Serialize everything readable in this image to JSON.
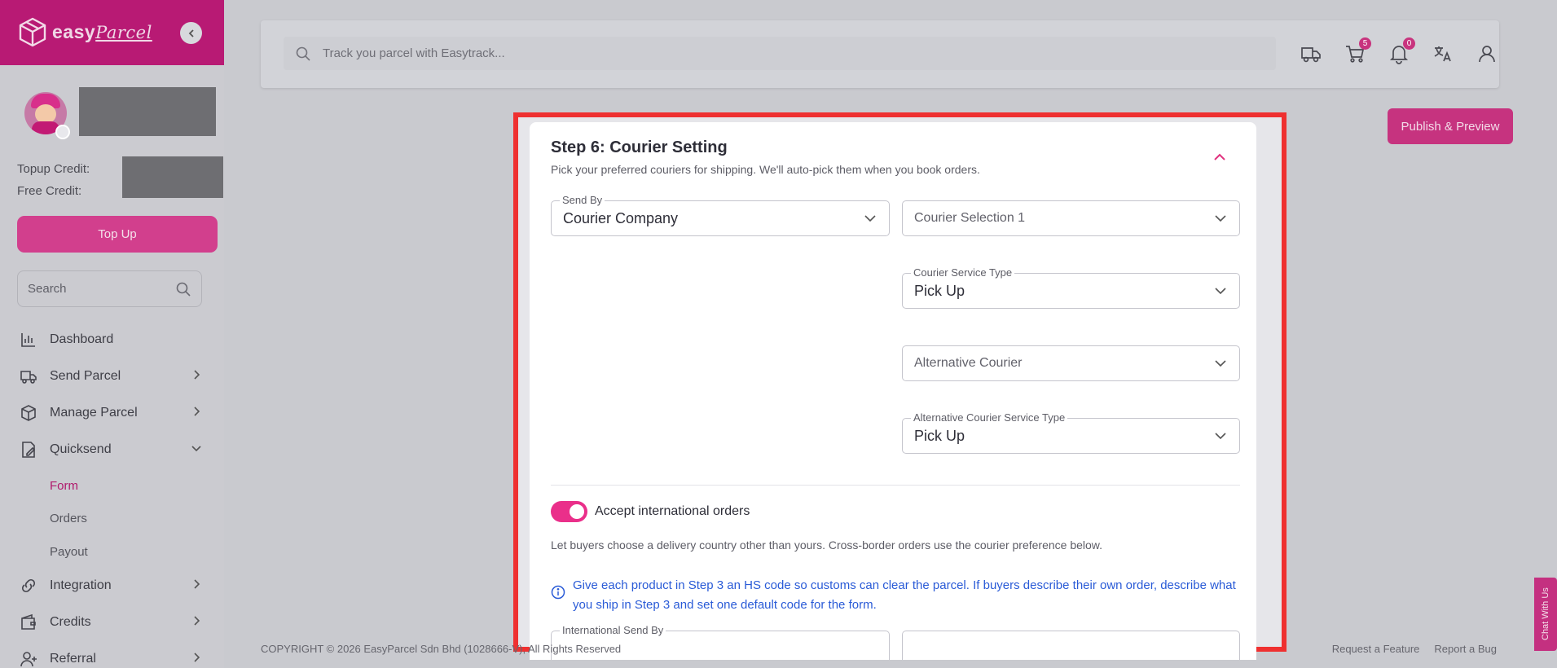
{
  "brand": {
    "name": "easy",
    "name_script": "Parcel"
  },
  "sidebar": {
    "credits": {
      "topup_label": "Topup Credit:",
      "free_label": "Free Credit:"
    },
    "topup_button": "Top Up",
    "search_placeholder": "Search",
    "nav": [
      {
        "label": "Dashboard",
        "icon": "chart-icon"
      },
      {
        "label": "Send Parcel",
        "icon": "truck-icon"
      },
      {
        "label": "Manage Parcel",
        "icon": "box-icon"
      },
      {
        "label": "Quicksend",
        "icon": "edit-icon"
      },
      {
        "label": "Integration",
        "icon": "link-icon"
      },
      {
        "label": "Credits",
        "icon": "wallet-icon"
      },
      {
        "label": "Referral",
        "icon": "user-plus-icon"
      }
    ],
    "quicksend_sub": [
      {
        "label": "Form",
        "active": true
      },
      {
        "label": "Orders",
        "active": false
      },
      {
        "label": "Payout",
        "active": false
      }
    ]
  },
  "topbar": {
    "search_placeholder": "Track you parcel with Easytrack...",
    "cart_count": "5",
    "notification_count": "0"
  },
  "publish_button": "Publish & Preview",
  "card": {
    "title": "Step 6: Courier Setting",
    "subtitle": "Pick your preferred couriers for shipping. We'll auto-pick them when you book orders.",
    "send_by": {
      "label": "Send By",
      "value": "Courier Company"
    },
    "courier_selection": {
      "placeholder": "Courier Selection 1"
    },
    "service_type": {
      "label": "Courier Service Type",
      "value": "Pick Up"
    },
    "alternative_courier": {
      "placeholder": "Alternative Courier"
    },
    "alt_service_type": {
      "label": "Alternative Courier Service Type",
      "value": "Pick Up"
    },
    "intl_toggle_label": "Accept international orders",
    "intl_description": "Let buyers choose a delivery country other than yours. Cross-border orders use the courier preference below.",
    "info_text": "Give each product in Step 3 an HS code so customs can clear the parcel. If buyers describe their own order, describe what you ship in Step 3 and set one default code for the form.",
    "intl_send_by_label": "International Send By"
  },
  "footer": {
    "copyright": "COPYRIGHT © 2026 EasyParcel Sdn Bhd (1028666-V), All Rights Reserved",
    "links": [
      "Request a Feature",
      "Report a Bug"
    ]
  },
  "chat_tab": "Chat With Us",
  "colors": {
    "brand": "#b81a74",
    "accent": "#ea2f8a",
    "highlight": "#ef3030",
    "info": "#2a5bd7"
  }
}
